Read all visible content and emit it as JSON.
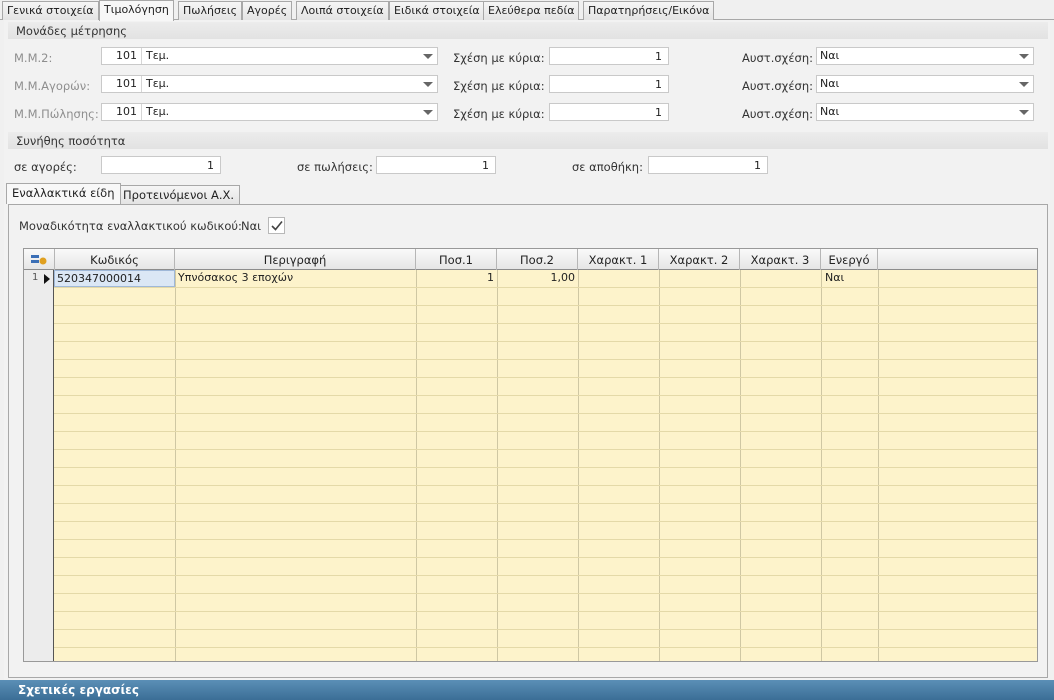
{
  "tabs": [
    "Γενικά στοιχεία",
    "Τιμολόγηση",
    "Πωλήσεις",
    "Αγορές",
    "Λοιπά στοιχεία",
    "Ειδικά στοιχεία",
    "Ελεύθερα πεδία",
    "Παρατηρήσεις/Εικόνα"
  ],
  "units": {
    "title": "Μονάδες μέτρησης",
    "rows": [
      {
        "label": "Μ.Μ.2:",
        "code": "101",
        "unit": "Τεμ.",
        "rel_label": "Σχέση με κύρια:",
        "rel": "1",
        "strict_label": "Αυστ.σχέση:",
        "strict": "Ναι"
      },
      {
        "label": "Μ.Μ.Αγορών:",
        "code": "101",
        "unit": "Τεμ.",
        "rel_label": "Σχέση με κύρια:",
        "rel": "1",
        "strict_label": "Αυστ.σχέση:",
        "strict": "Ναι"
      },
      {
        "label": "Μ.Μ.Πώλησης:",
        "code": "101",
        "unit": "Τεμ.",
        "rel_label": "Σχέση με κύρια:",
        "rel": "1",
        "strict_label": "Αυστ.σχέση:",
        "strict": "Ναι"
      }
    ]
  },
  "qty": {
    "title": "Συνήθης ποσότητα",
    "purchases_label": "σε αγορές:",
    "purchases": "1",
    "sales_label": "σε πωλήσεις:",
    "sales": "1",
    "storage_label": "σε αποθήκη:",
    "storage": "1"
  },
  "inner_tabs": [
    "Εναλλακτικά είδη",
    "Προτεινόμενοι Α.Χ."
  ],
  "uniqueness": {
    "label": "Μοναδικότητα εναλλακτικού κωδικού:",
    "value": "Ναι"
  },
  "grid": {
    "columns": [
      "Κωδικός",
      "Περιγραφή",
      "Ποσ.1",
      "Ποσ.2",
      "Χαρακτ. 1",
      "Χαρακτ. 2",
      "Χαρακτ. 3",
      "Ενεργό"
    ],
    "rows": [
      {
        "num": "1",
        "code": "520347000014",
        "desc": "Υπνόσακος 3 εποχών",
        "q1": "1",
        "q2": "1,00",
        "c1": "",
        "c2": "",
        "c3": "",
        "active": "Ναι"
      }
    ]
  },
  "bottom_bar": "Σχετικές εργασίες",
  "colors": {
    "grid_bg": "#fdf3cb",
    "bar": "#3b6e96"
  }
}
